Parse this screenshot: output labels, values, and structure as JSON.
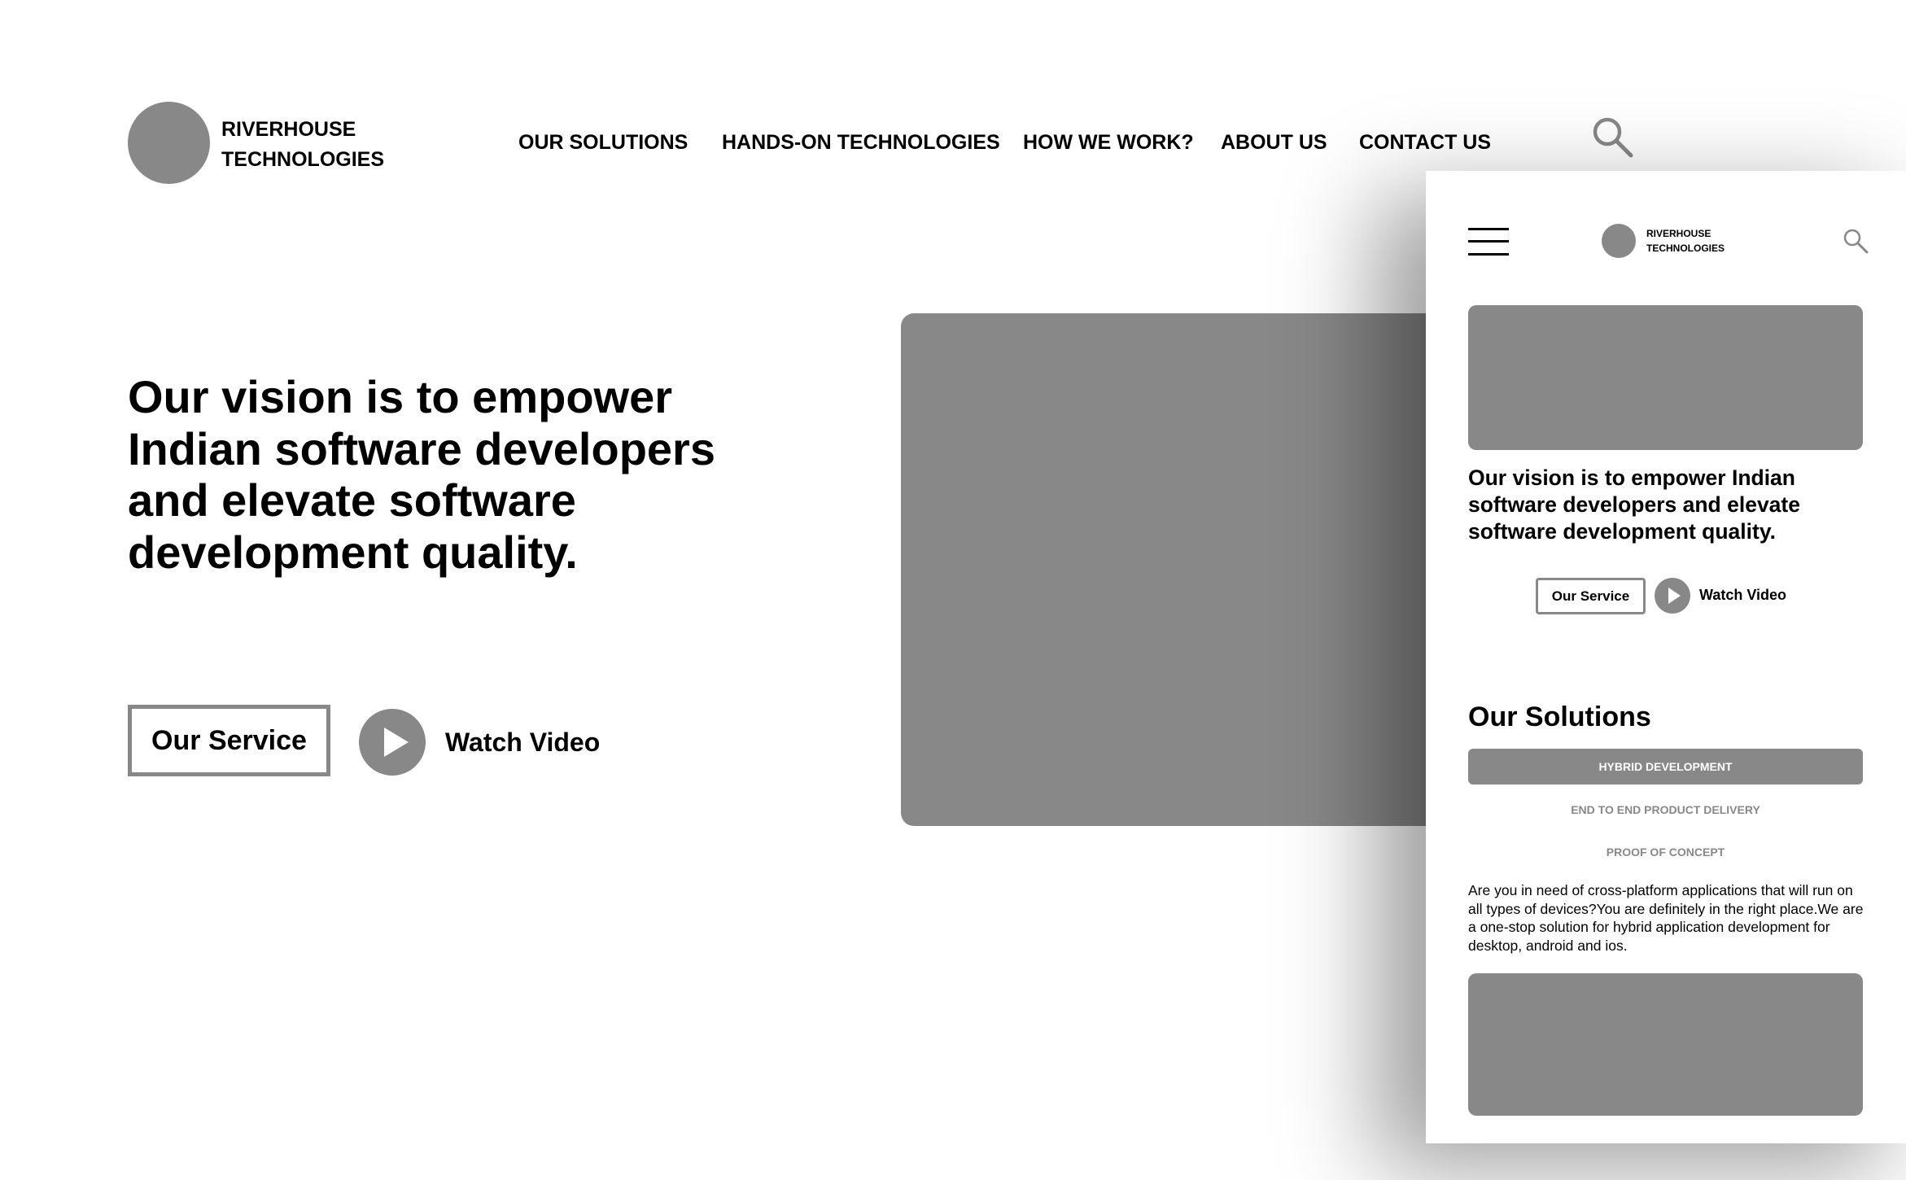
{
  "desktop": {
    "brand": {
      "line1": "RIVERHOUSE",
      "line2": "TECHNOLOGIES"
    },
    "nav": [
      {
        "label": "OUR SOLUTIONS"
      },
      {
        "label": "HANDS-ON TECHNOLOGIES"
      },
      {
        "label": "HOW WE WORK?"
      },
      {
        "label": "ABOUT US"
      },
      {
        "label": "CONTACT US"
      }
    ],
    "search_icon": "search-icon",
    "hero": {
      "headline": "Our vision is to empower Indian software developers and elevate software development quality.",
      "service_button": "Our Service",
      "watch_label": "Watch Video",
      "play_icon": "play-icon"
    }
  },
  "mobile": {
    "menu_icon": "hamburger-menu-icon",
    "brand": {
      "line1": "RIVERHOUSE",
      "line2": "TECHNOLOGIES"
    },
    "search_icon": "search-icon",
    "hero": {
      "headline": "Our vision is to empower Indian software developers and elevate software development quality.",
      "service_button": "Our Service",
      "watch_label": "Watch Video",
      "play_icon": "play-icon"
    },
    "solutions": {
      "title": "Our Solutions",
      "tabs": [
        {
          "label": "HYBRID DEVELOPMENT",
          "active": true
        },
        {
          "label": "END TO END PRODUCT DELIVERY",
          "active": false
        },
        {
          "label": "PROOF OF CONCEPT",
          "active": false
        }
      ],
      "description": "Are you in need of cross-platform applications that will run on all types of devices?You are definitely in the right place.We are a one-stop solution for hybrid application development for desktop, android and ios."
    }
  },
  "colors": {
    "placeholder_gray": "#888888",
    "text": "#000000",
    "background": "#ffffff"
  }
}
